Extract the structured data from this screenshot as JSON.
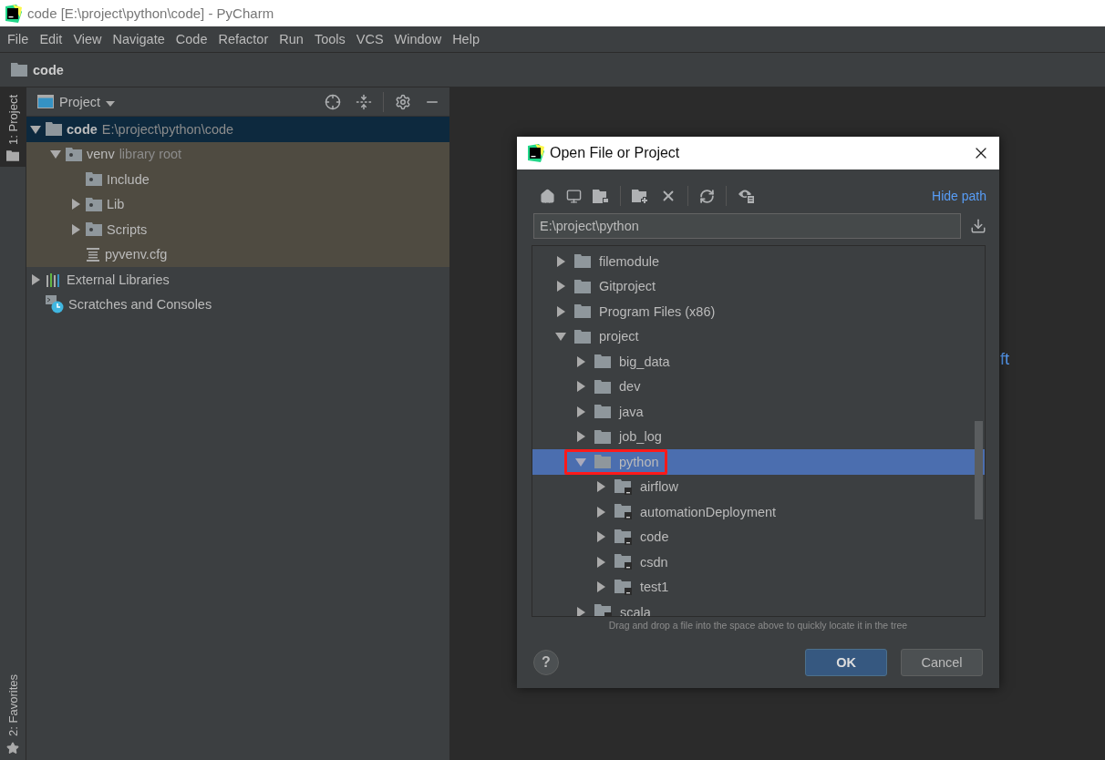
{
  "window": {
    "title": "code [E:\\project\\python\\code] - PyCharm"
  },
  "menu": [
    "File",
    "Edit",
    "View",
    "Navigate",
    "Code",
    "Refactor",
    "Run",
    "Tools",
    "VCS",
    "Window",
    "Help"
  ],
  "breadcrumb": "code",
  "side_tabs": [
    {
      "label": "1: Project",
      "selected": true,
      "kind": "folder"
    },
    {
      "label": "2: Favorites",
      "selected": false,
      "kind": "star"
    }
  ],
  "project_panel": {
    "title": "Project",
    "tree": [
      {
        "label": "code",
        "hint": "E:\\project\\python\\code",
        "kind": "folder",
        "expanded": true,
        "selected": true,
        "tinted": false,
        "children": [
          {
            "label": "venv",
            "hint": "library root",
            "kind": "lib-folder",
            "expanded": true,
            "selected": false,
            "tinted": true,
            "children": [
              {
                "label": "Include",
                "kind": "lib-folder",
                "selected": false,
                "tinted": true
              },
              {
                "label": "Lib",
                "kind": "lib-folder",
                "expanded": false,
                "selected": false,
                "tinted": true
              },
              {
                "label": "Scripts",
                "kind": "lib-folder",
                "expanded": false,
                "selected": false,
                "tinted": true
              },
              {
                "label": "pyvenv.cfg",
                "kind": "file",
                "selected": false,
                "tinted": true
              }
            ]
          }
        ]
      },
      {
        "label": "External Libraries",
        "kind": "libraries",
        "expanded": false,
        "selected": false,
        "tinted": false
      },
      {
        "label": "Scratches and Consoles",
        "kind": "scratches",
        "selected": false,
        "tinted": false
      }
    ]
  },
  "editor": {
    "text": "ft"
  },
  "dialog": {
    "title": "Open File or Project",
    "hide_path": "Hide path",
    "path": "E:\\project\\python",
    "tree": [
      {
        "label": "filemodule",
        "kind": "folder",
        "expanded": false,
        "selected": false
      },
      {
        "label": "Gitproject",
        "kind": "folder",
        "expanded": false,
        "selected": false
      },
      {
        "label": "Program Files (x86)",
        "kind": "folder",
        "expanded": false,
        "selected": false
      },
      {
        "label": "project",
        "kind": "folder",
        "expanded": true,
        "selected": false,
        "children": [
          {
            "label": "big_data",
            "kind": "folder",
            "expanded": false,
            "selected": false
          },
          {
            "label": "dev",
            "kind": "folder",
            "expanded": false,
            "selected": false
          },
          {
            "label": "java",
            "kind": "folder",
            "expanded": false,
            "selected": false
          },
          {
            "label": "job_log",
            "kind": "folder",
            "expanded": false,
            "selected": false
          },
          {
            "label": "python",
            "kind": "folder",
            "expanded": true,
            "selected": true,
            "annotated": true,
            "children": [
              {
                "label": "airflow",
                "kind": "module",
                "expanded": false,
                "selected": false
              },
              {
                "label": "automationDeployment",
                "kind": "module",
                "expanded": false,
                "selected": false
              },
              {
                "label": "code",
                "kind": "module",
                "expanded": false,
                "selected": false
              },
              {
                "label": "csdn",
                "kind": "module",
                "expanded": false,
                "selected": false
              },
              {
                "label": "test1",
                "kind": "module",
                "expanded": false,
                "selected": false
              }
            ]
          },
          {
            "label": "scala",
            "kind": "module",
            "expanded": false,
            "selected": false
          }
        ]
      }
    ],
    "hint": "Drag and drop a file into the space above to quickly locate it in the tree",
    "help": "?",
    "ok": "OK",
    "cancel": "Cancel"
  }
}
